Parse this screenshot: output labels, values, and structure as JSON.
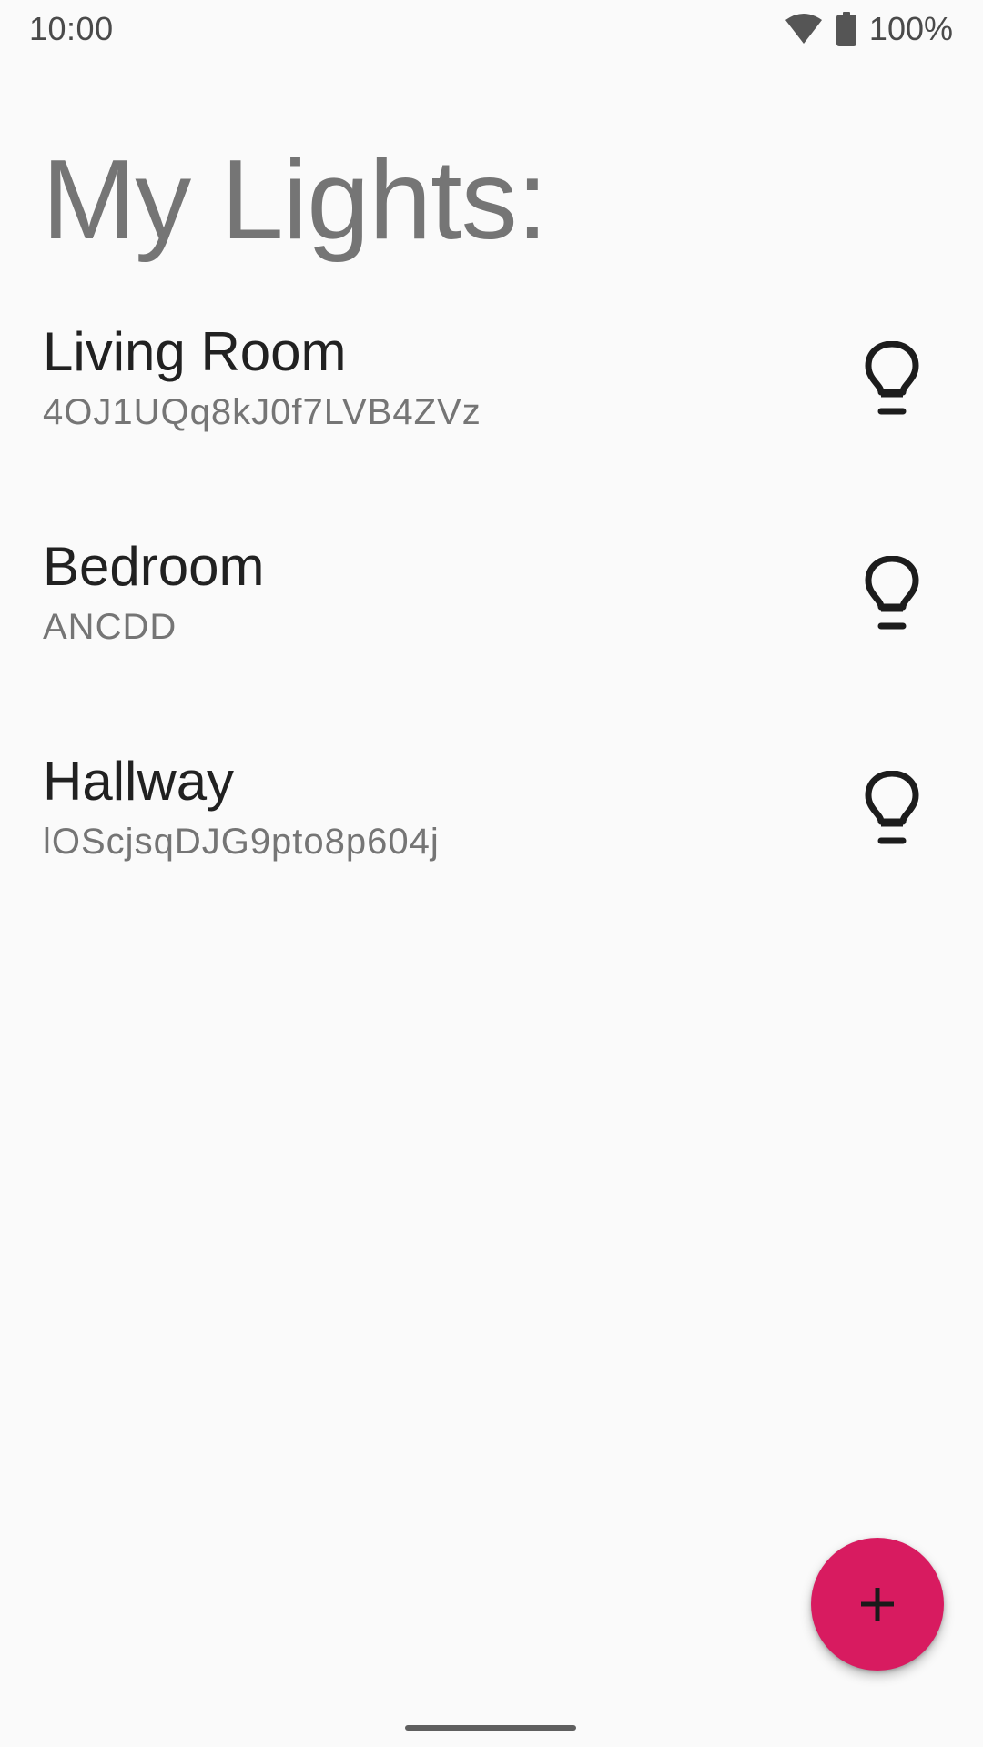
{
  "status_bar": {
    "time": "10:00",
    "battery_text": "100%",
    "icons": [
      "wifi-icon",
      "battery-icon"
    ]
  },
  "title": "My Lights:",
  "lights": [
    {
      "name": "Living Room",
      "id": "4OJ1UQq8kJ0f7LVB4ZVz",
      "icon": "lightbulb-icon"
    },
    {
      "name": "Bedroom",
      "id": "ANCDD",
      "icon": "lightbulb-icon"
    },
    {
      "name": "Hallway",
      "id": "lOScjsqDJG9pto8p604j",
      "icon": "lightbulb-icon"
    }
  ],
  "fab": {
    "icon": "plus-icon",
    "color": "#d81b60"
  },
  "colors": {
    "background": "#fafafa",
    "title": "#757575",
    "item_name": "#212121",
    "item_id": "#757575",
    "accent": "#d81b60"
  }
}
